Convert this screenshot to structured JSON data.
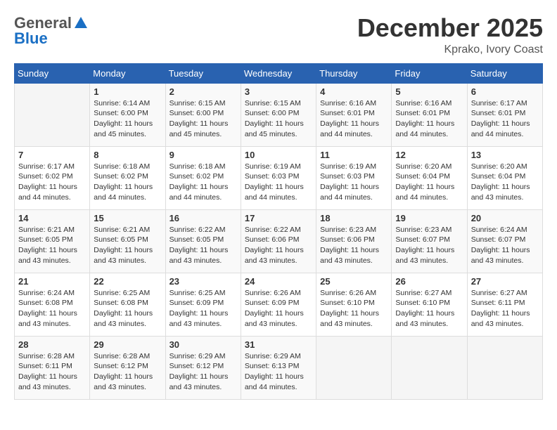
{
  "header": {
    "logo_general": "General",
    "logo_blue": "Blue",
    "month_title": "December 2025",
    "location": "Kprako, Ivory Coast"
  },
  "days_of_week": [
    "Sunday",
    "Monday",
    "Tuesday",
    "Wednesday",
    "Thursday",
    "Friday",
    "Saturday"
  ],
  "weeks": [
    [
      {
        "day": "",
        "info": ""
      },
      {
        "day": "1",
        "info": "Sunrise: 6:14 AM\nSunset: 6:00 PM\nDaylight: 11 hours\nand 45 minutes."
      },
      {
        "day": "2",
        "info": "Sunrise: 6:15 AM\nSunset: 6:00 PM\nDaylight: 11 hours\nand 45 minutes."
      },
      {
        "day": "3",
        "info": "Sunrise: 6:15 AM\nSunset: 6:00 PM\nDaylight: 11 hours\nand 45 minutes."
      },
      {
        "day": "4",
        "info": "Sunrise: 6:16 AM\nSunset: 6:01 PM\nDaylight: 11 hours\nand 44 minutes."
      },
      {
        "day": "5",
        "info": "Sunrise: 6:16 AM\nSunset: 6:01 PM\nDaylight: 11 hours\nand 44 minutes."
      },
      {
        "day": "6",
        "info": "Sunrise: 6:17 AM\nSunset: 6:01 PM\nDaylight: 11 hours\nand 44 minutes."
      }
    ],
    [
      {
        "day": "7",
        "info": "Sunrise: 6:17 AM\nSunset: 6:02 PM\nDaylight: 11 hours\nand 44 minutes."
      },
      {
        "day": "8",
        "info": "Sunrise: 6:18 AM\nSunset: 6:02 PM\nDaylight: 11 hours\nand 44 minutes."
      },
      {
        "day": "9",
        "info": "Sunrise: 6:18 AM\nSunset: 6:02 PM\nDaylight: 11 hours\nand 44 minutes."
      },
      {
        "day": "10",
        "info": "Sunrise: 6:19 AM\nSunset: 6:03 PM\nDaylight: 11 hours\nand 44 minutes."
      },
      {
        "day": "11",
        "info": "Sunrise: 6:19 AM\nSunset: 6:03 PM\nDaylight: 11 hours\nand 44 minutes."
      },
      {
        "day": "12",
        "info": "Sunrise: 6:20 AM\nSunset: 6:04 PM\nDaylight: 11 hours\nand 44 minutes."
      },
      {
        "day": "13",
        "info": "Sunrise: 6:20 AM\nSunset: 6:04 PM\nDaylight: 11 hours\nand 43 minutes."
      }
    ],
    [
      {
        "day": "14",
        "info": "Sunrise: 6:21 AM\nSunset: 6:05 PM\nDaylight: 11 hours\nand 43 minutes."
      },
      {
        "day": "15",
        "info": "Sunrise: 6:21 AM\nSunset: 6:05 PM\nDaylight: 11 hours\nand 43 minutes."
      },
      {
        "day": "16",
        "info": "Sunrise: 6:22 AM\nSunset: 6:05 PM\nDaylight: 11 hours\nand 43 minutes."
      },
      {
        "day": "17",
        "info": "Sunrise: 6:22 AM\nSunset: 6:06 PM\nDaylight: 11 hours\nand 43 minutes."
      },
      {
        "day": "18",
        "info": "Sunrise: 6:23 AM\nSunset: 6:06 PM\nDaylight: 11 hours\nand 43 minutes."
      },
      {
        "day": "19",
        "info": "Sunrise: 6:23 AM\nSunset: 6:07 PM\nDaylight: 11 hours\nand 43 minutes."
      },
      {
        "day": "20",
        "info": "Sunrise: 6:24 AM\nSunset: 6:07 PM\nDaylight: 11 hours\nand 43 minutes."
      }
    ],
    [
      {
        "day": "21",
        "info": "Sunrise: 6:24 AM\nSunset: 6:08 PM\nDaylight: 11 hours\nand 43 minutes."
      },
      {
        "day": "22",
        "info": "Sunrise: 6:25 AM\nSunset: 6:08 PM\nDaylight: 11 hours\nand 43 minutes."
      },
      {
        "day": "23",
        "info": "Sunrise: 6:25 AM\nSunset: 6:09 PM\nDaylight: 11 hours\nand 43 minutes."
      },
      {
        "day": "24",
        "info": "Sunrise: 6:26 AM\nSunset: 6:09 PM\nDaylight: 11 hours\nand 43 minutes."
      },
      {
        "day": "25",
        "info": "Sunrise: 6:26 AM\nSunset: 6:10 PM\nDaylight: 11 hours\nand 43 minutes."
      },
      {
        "day": "26",
        "info": "Sunrise: 6:27 AM\nSunset: 6:10 PM\nDaylight: 11 hours\nand 43 minutes."
      },
      {
        "day": "27",
        "info": "Sunrise: 6:27 AM\nSunset: 6:11 PM\nDaylight: 11 hours\nand 43 minutes."
      }
    ],
    [
      {
        "day": "28",
        "info": "Sunrise: 6:28 AM\nSunset: 6:11 PM\nDaylight: 11 hours\nand 43 minutes."
      },
      {
        "day": "29",
        "info": "Sunrise: 6:28 AM\nSunset: 6:12 PM\nDaylight: 11 hours\nand 43 minutes."
      },
      {
        "day": "30",
        "info": "Sunrise: 6:29 AM\nSunset: 6:12 PM\nDaylight: 11 hours\nand 43 minutes."
      },
      {
        "day": "31",
        "info": "Sunrise: 6:29 AM\nSunset: 6:13 PM\nDaylight: 11 hours\nand 44 minutes."
      },
      {
        "day": "",
        "info": ""
      },
      {
        "day": "",
        "info": ""
      },
      {
        "day": "",
        "info": ""
      }
    ]
  ]
}
